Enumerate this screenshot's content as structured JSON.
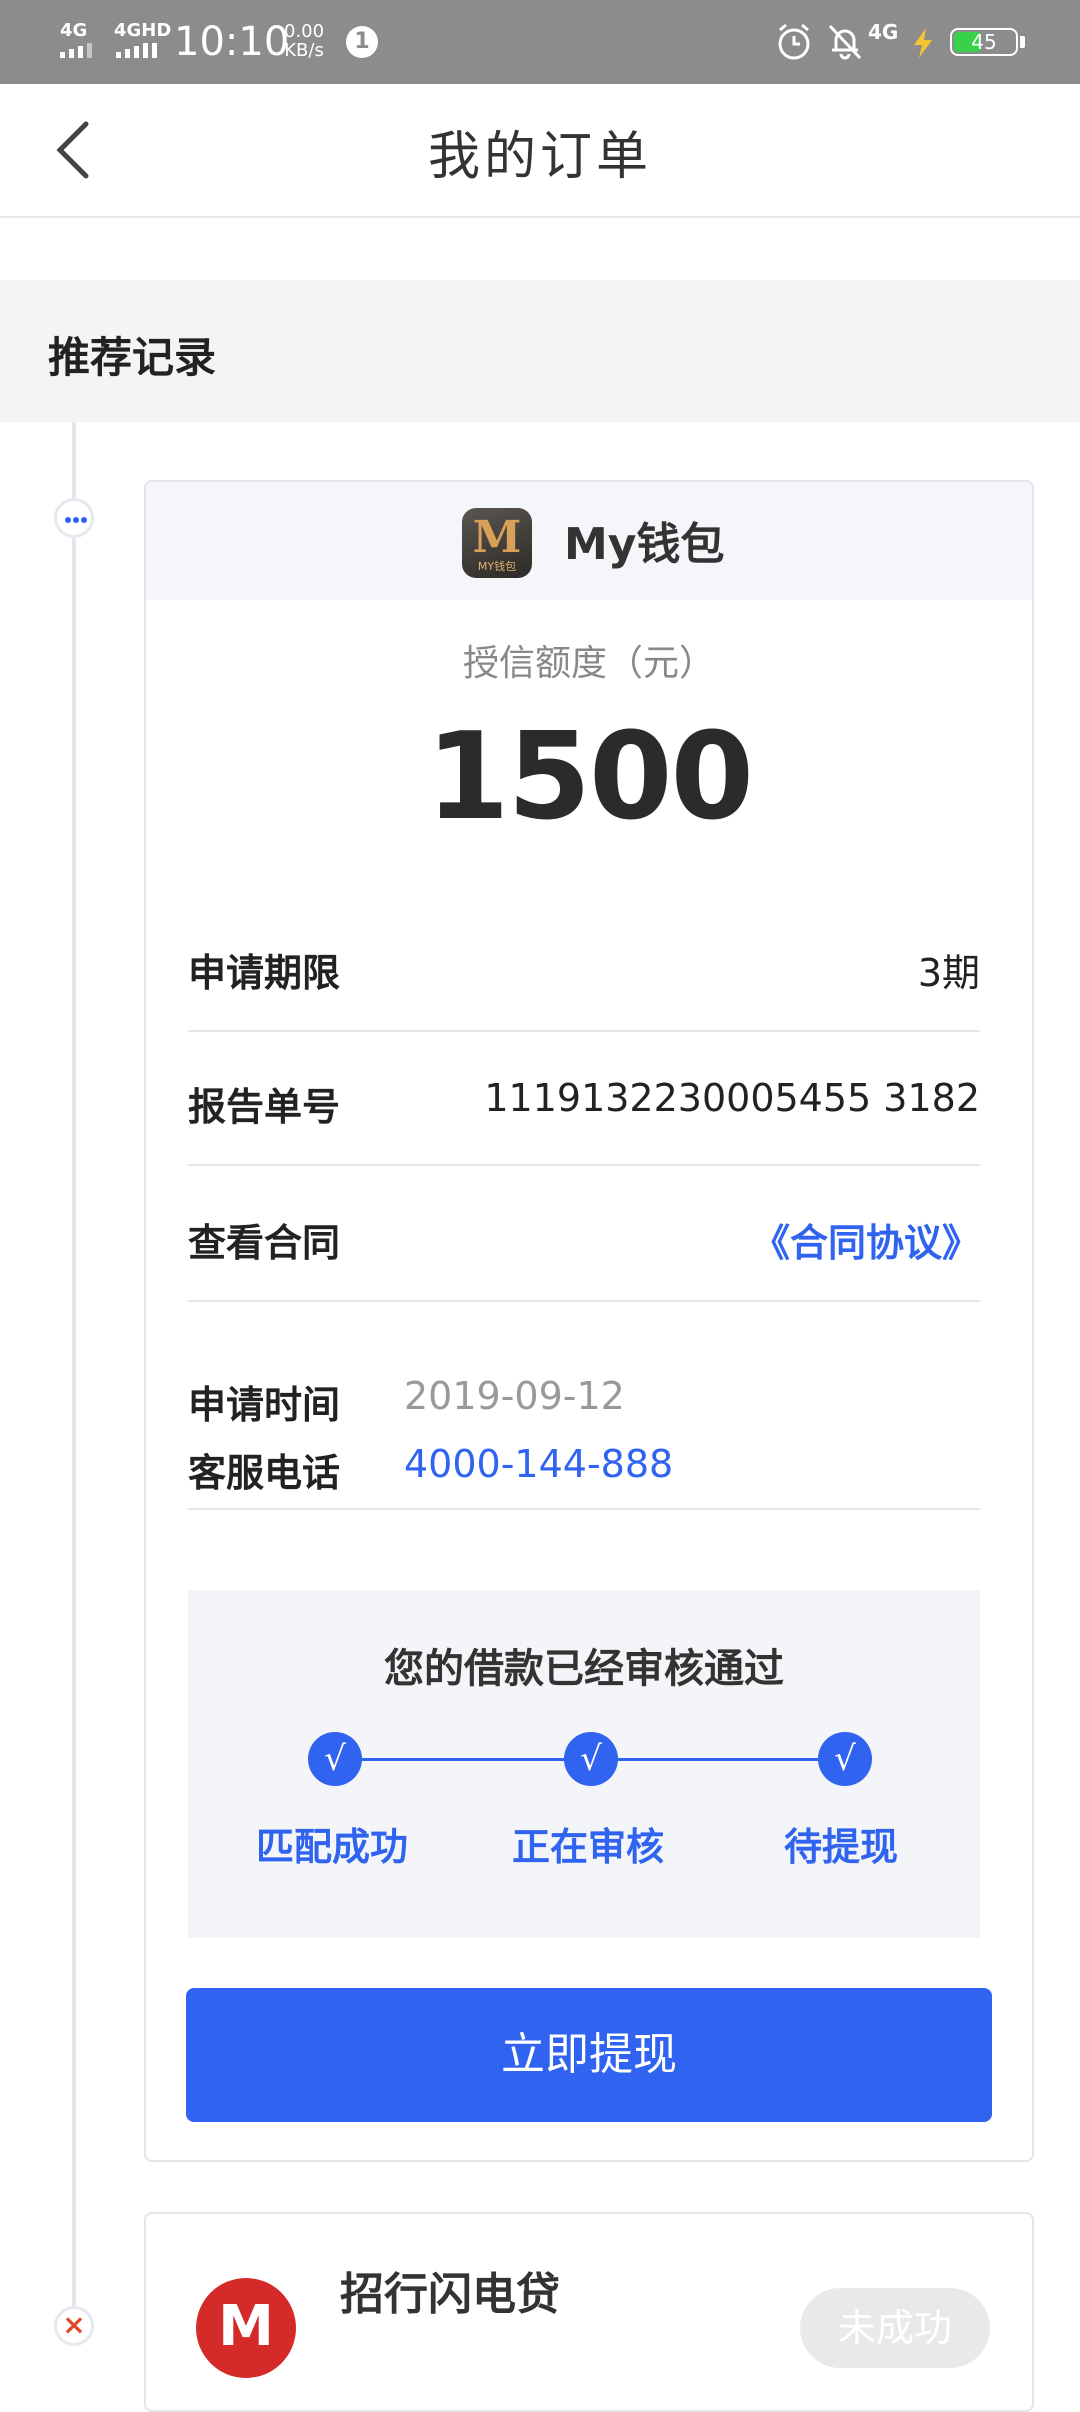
{
  "status_bar": {
    "network1": "4G",
    "network2": "4GHD",
    "time": "10:10",
    "speed_value": "0.00",
    "speed_unit": "KB/s",
    "notification_count": "1",
    "network3": "4G",
    "battery_level": "45",
    "icons": [
      "alarm-icon",
      "mute-icon",
      "charging-icon"
    ]
  },
  "header": {
    "title": "我的订单"
  },
  "section": {
    "title": "推荐记录"
  },
  "order": {
    "app_name": "My钱包",
    "app_logo_text": "M",
    "app_logo_sub": "MY钱包",
    "credit_label": "授信额度（元）",
    "credit_amount": "1500",
    "rows": [
      {
        "label": "申请期限",
        "value": "3期"
      },
      {
        "label": "报告单号",
        "value": "1119132230005455 3182"
      },
      {
        "label": "查看合同",
        "value": "《合同协议》"
      }
    ],
    "apply_time_label": "申请时间",
    "apply_time": "2019-09-12",
    "service_phone_label": "客服电话",
    "service_phone": "4000-144-888",
    "status_title": "您的借款已经审核通过",
    "steps": [
      "匹配成功",
      "正在审核",
      "待提现"
    ],
    "step_check": "√",
    "action_label": "立即提现"
  },
  "order2": {
    "app_name": "招行闪电贷",
    "status": "未成功"
  },
  "colors": {
    "accent": "#2f63f0",
    "status_bar": "#8c8c8c",
    "error": "#e24a2a"
  }
}
